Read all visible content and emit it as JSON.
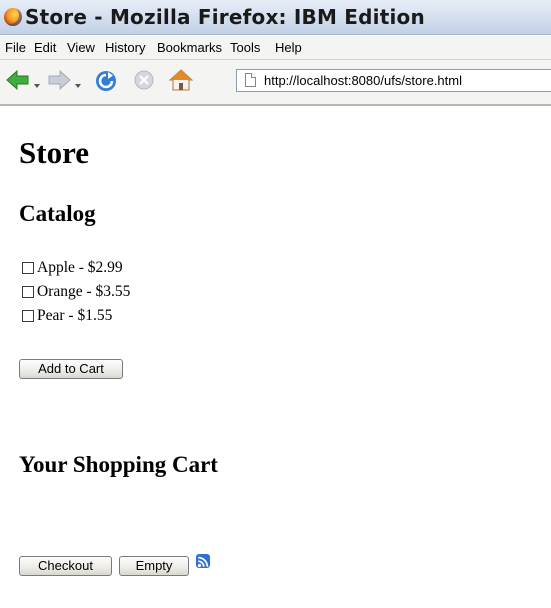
{
  "window": {
    "title": "Store - Mozilla Firefox: IBM Edition"
  },
  "menubar": {
    "items": [
      "File",
      "Edit",
      "View",
      "History",
      "Bookmarks",
      "Tools",
      "Help"
    ]
  },
  "navigation": {
    "url": "http://localhost:8080/ufs/store.html"
  },
  "page": {
    "heading": "Store",
    "catalog": {
      "heading": "Catalog",
      "items": [
        {
          "label": "Apple - $2.99",
          "checked": false
        },
        {
          "label": "Orange - $3.55",
          "checked": false
        },
        {
          "label": "Pear - $1.55",
          "checked": false
        }
      ],
      "add_button_label": "Add to Cart"
    },
    "cart": {
      "heading": "Your Shopping Cart",
      "checkout_label": "Checkout",
      "empty_label": "Empty"
    }
  },
  "colors": {
    "back_arrow": "#3fae3f",
    "reload": "#2f7fd8",
    "home": "#e08a2a",
    "rss": "#2f6fd6"
  }
}
